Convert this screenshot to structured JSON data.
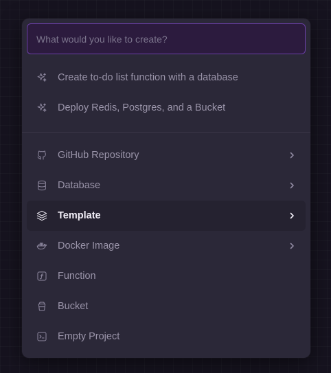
{
  "search": {
    "placeholder": "What would you like to create?",
    "value": ""
  },
  "suggestions": [
    {
      "label": "Create to-do list function with a database",
      "icon": "sparkle-icon"
    },
    {
      "label": "Deploy Redis, Postgres, and a Bucket",
      "icon": "sparkle-icon"
    }
  ],
  "options": [
    {
      "label": "GitHub Repository",
      "icon": "github-icon",
      "has_submenu": true
    },
    {
      "label": "Database",
      "icon": "database-icon",
      "has_submenu": true
    },
    {
      "label": "Template",
      "icon": "layers-icon",
      "has_submenu": true,
      "selected": true
    },
    {
      "label": "Docker Image",
      "icon": "docker-icon",
      "has_submenu": true
    },
    {
      "label": "Function",
      "icon": "function-icon",
      "has_submenu": false
    },
    {
      "label": "Bucket",
      "icon": "bucket-icon",
      "has_submenu": false
    },
    {
      "label": "Empty Project",
      "icon": "terminal-icon",
      "has_submenu": false
    }
  ],
  "colors": {
    "background": "#16131f",
    "panel": "#2b2838",
    "accent_border": "#6a3fa6",
    "selected_row": "#252230",
    "text_muted": "#9a94a9",
    "text_selected": "#f1eef7"
  }
}
